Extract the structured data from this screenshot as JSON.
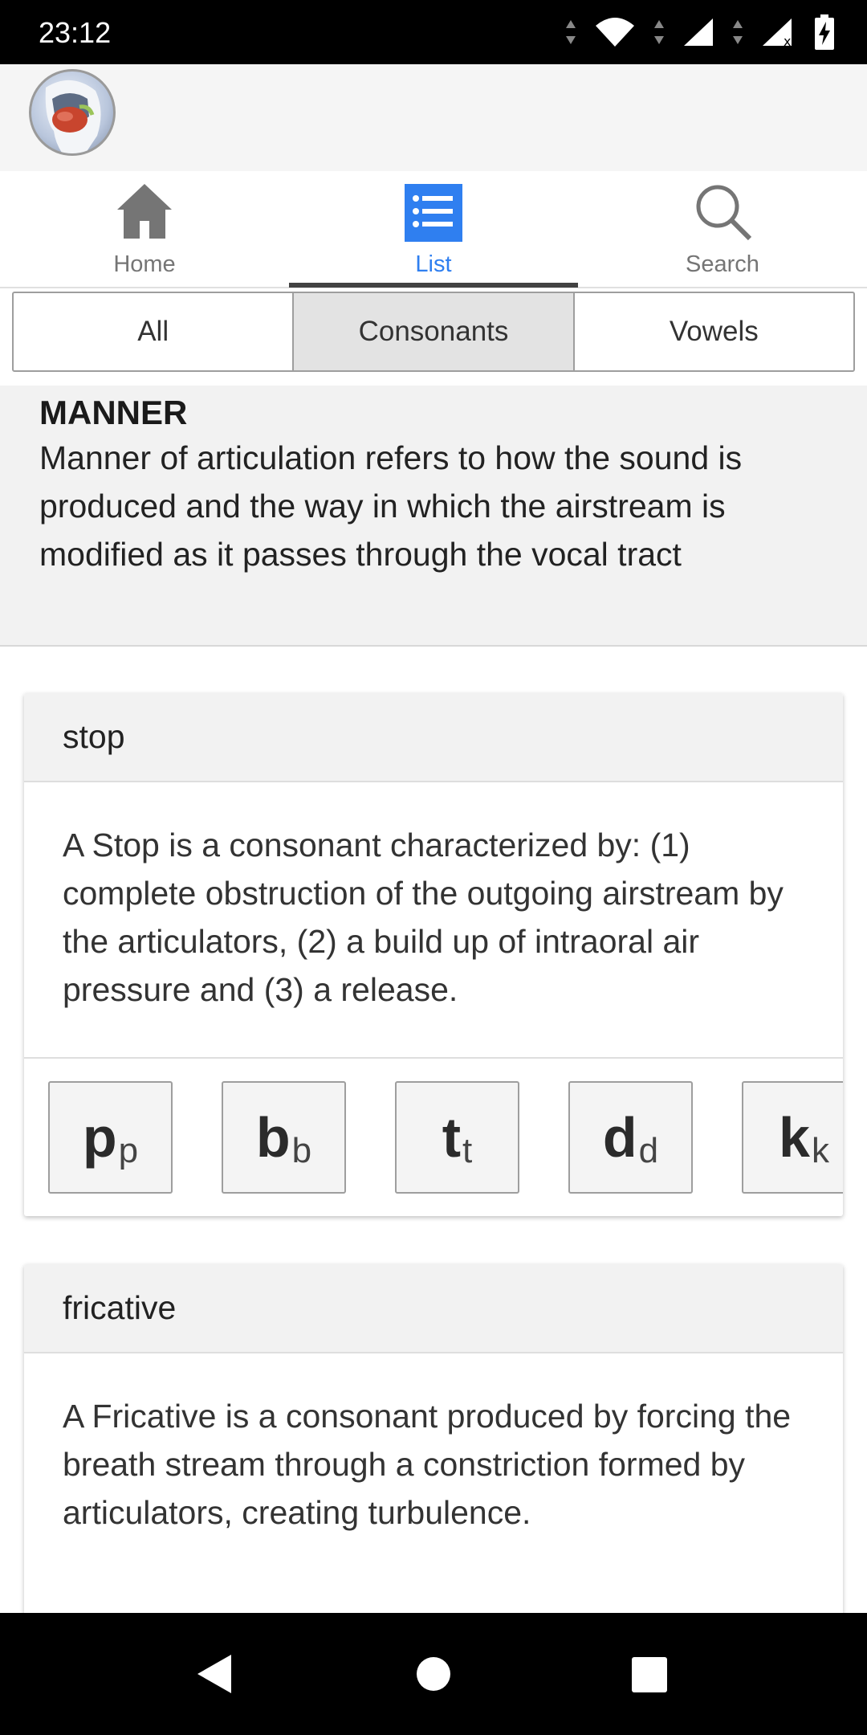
{
  "status_bar": {
    "time": "23:12"
  },
  "nav": {
    "tabs": [
      {
        "label": "Home",
        "icon": "home-icon"
      },
      {
        "label": "List",
        "icon": "list-icon"
      },
      {
        "label": "Search",
        "icon": "search-icon"
      }
    ],
    "active": "List"
  },
  "filters": {
    "options": [
      "All",
      "Consonants",
      "Vowels"
    ],
    "selected": "Consonants"
  },
  "manner": {
    "title": "MANNER",
    "description": "Manner of articulation refers to how the sound is produced and the way in which the airstream is modified as it passes through the vocal tract"
  },
  "cards": [
    {
      "title": "stop",
      "description": "A Stop is a consonant characterized by: (1) complete obstruction of the outgoing airstream by the articulators, (2) a build up of intraoral air pressure and (3) a release.",
      "sounds": [
        {
          "symbol": "p",
          "sub": "p"
        },
        {
          "symbol": "b",
          "sub": "b"
        },
        {
          "symbol": "t",
          "sub": "t"
        },
        {
          "symbol": "d",
          "sub": "d"
        },
        {
          "symbol": "k",
          "sub": "k"
        }
      ]
    },
    {
      "title": "fricative",
      "description": "A Fricative is a consonant produced by forcing the breath stream through a constriction formed by articulators, creating turbulence."
    }
  ],
  "colors": {
    "accent": "#2f7ff0",
    "status_bar": "#000000",
    "header_bg": "#f5f5f5"
  }
}
